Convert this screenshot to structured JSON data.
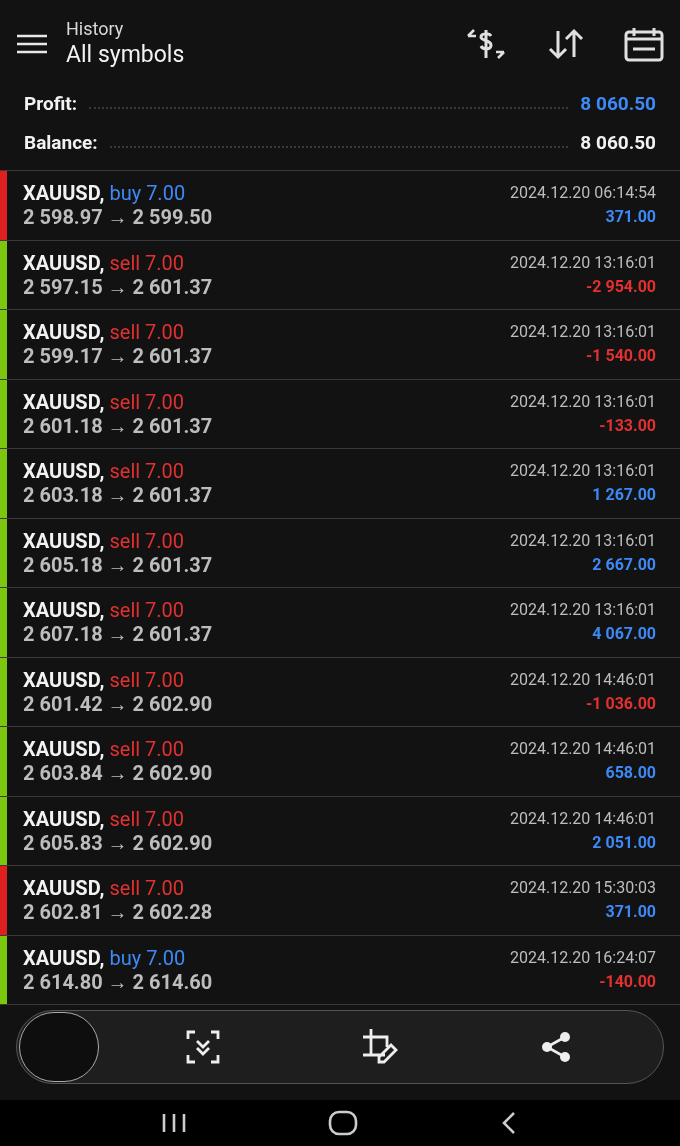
{
  "header": {
    "subtitle": "History",
    "title": "All symbols"
  },
  "summary": [
    {
      "label": "Profit:",
      "value": "8 060.50",
      "kind": "profit"
    },
    {
      "label": "Balance:",
      "value": "8 060.50",
      "kind": "balance"
    }
  ],
  "deals": [
    {
      "symbol": "XAUUSD,",
      "kind": "buy",
      "volume": "buy 7.00",
      "prices": "2 598.97 → 2 599.50",
      "time": "2024.12.20 06:14:54",
      "profit": "371.00",
      "loss": false,
      "color": "#e02020"
    },
    {
      "symbol": "XAUUSD,",
      "kind": "sell",
      "volume": "sell 7.00",
      "prices": "2 597.15 → 2 601.37",
      "time": "2024.12.20 13:16:01",
      "profit": "-2 954.00",
      "loss": true,
      "color": "#7ac70c"
    },
    {
      "symbol": "XAUUSD,",
      "kind": "sell",
      "volume": "sell 7.00",
      "prices": "2 599.17 → 2 601.37",
      "time": "2024.12.20 13:16:01",
      "profit": "-1 540.00",
      "loss": true,
      "color": "#7ac70c"
    },
    {
      "symbol": "XAUUSD,",
      "kind": "sell",
      "volume": "sell 7.00",
      "prices": "2 601.18 → 2 601.37",
      "time": "2024.12.20 13:16:01",
      "profit": "-133.00",
      "loss": true,
      "color": "#7ac70c"
    },
    {
      "symbol": "XAUUSD,",
      "kind": "sell",
      "volume": "sell 7.00",
      "prices": "2 603.18 → 2 601.37",
      "time": "2024.12.20 13:16:01",
      "profit": "1 267.00",
      "loss": false,
      "color": "#7ac70c"
    },
    {
      "symbol": "XAUUSD,",
      "kind": "sell",
      "volume": "sell 7.00",
      "prices": "2 605.18 → 2 601.37",
      "time": "2024.12.20 13:16:01",
      "profit": "2 667.00",
      "loss": false,
      "color": "#7ac70c"
    },
    {
      "symbol": "XAUUSD,",
      "kind": "sell",
      "volume": "sell 7.00",
      "prices": "2 607.18 → 2 601.37",
      "time": "2024.12.20 13:16:01",
      "profit": "4 067.00",
      "loss": false,
      "color": "#7ac70c"
    },
    {
      "symbol": "XAUUSD,",
      "kind": "sell",
      "volume": "sell 7.00",
      "prices": "2 601.42 → 2 602.90",
      "time": "2024.12.20 14:46:01",
      "profit": "-1 036.00",
      "loss": true,
      "color": "#7ac70c"
    },
    {
      "symbol": "XAUUSD,",
      "kind": "sell",
      "volume": "sell 7.00",
      "prices": "2 603.84 → 2 602.90",
      "time": "2024.12.20 14:46:01",
      "profit": "658.00",
      "loss": false,
      "color": "#7ac70c"
    },
    {
      "symbol": "XAUUSD,",
      "kind": "sell",
      "volume": "sell 7.00",
      "prices": "2 605.83 → 2 602.90",
      "time": "2024.12.20 14:46:01",
      "profit": "2 051.00",
      "loss": false,
      "color": "#7ac70c"
    },
    {
      "symbol": "XAUUSD,",
      "kind": "sell",
      "volume": "sell 7.00",
      "prices": "2 602.81 → 2 602.28",
      "time": "2024.12.20 15:30:03",
      "profit": "371.00",
      "loss": false,
      "color": "#e02020"
    },
    {
      "symbol": "XAUUSD,",
      "kind": "buy",
      "volume": "buy 7.00",
      "prices": "2 614.80 → 2 614.60",
      "time": "2024.12.20 16:24:07",
      "profit": "-140.00",
      "loss": true,
      "color": "#7ac70c"
    }
  ]
}
